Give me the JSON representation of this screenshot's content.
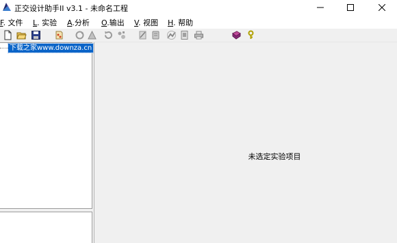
{
  "window": {
    "title": "正交设计助手II v3.1 - 未命名工程"
  },
  "menu": [
    {
      "accel": "F",
      "label": ". 文件"
    },
    {
      "accel": "L",
      "label": ". 实验"
    },
    {
      "accel": "A",
      "label": ".分析"
    },
    {
      "accel": "O",
      "label": ".输出"
    },
    {
      "accel": "V",
      "label": ". 视图"
    },
    {
      "accel": "H",
      "label": ". 帮助"
    }
  ],
  "tree": {
    "root_label": "下载之家www.downza.cn"
  },
  "main": {
    "empty_message": "未选定实验项目"
  },
  "colors": {
    "selection": "#0a64c8",
    "background": "#f0f0f0",
    "panel": "#ffffff"
  }
}
